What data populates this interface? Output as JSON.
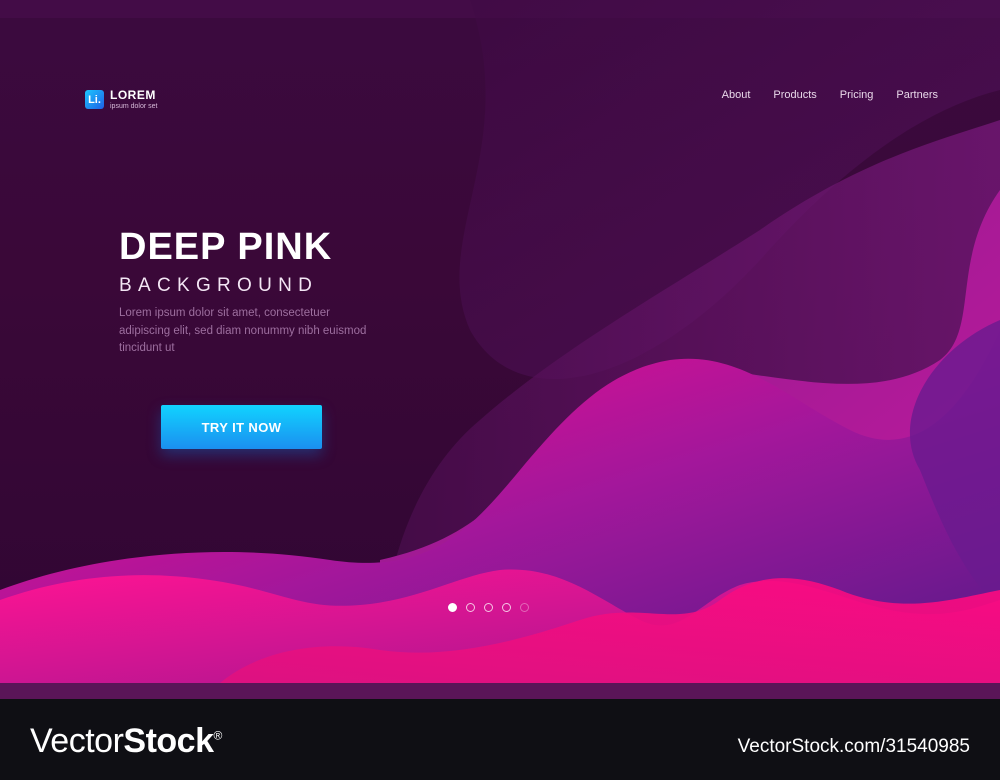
{
  "header": {
    "logo_mark": "Li.",
    "logo_name": "LOREM",
    "logo_tagline": "ipsum dolor set",
    "nav": [
      "About",
      "Products",
      "Pricing",
      "Partners"
    ]
  },
  "hero": {
    "title": "DEEP PINK",
    "subtitle": "BACKGROUND",
    "body": "Lorem ipsum dolor sit amet, consectetuer adipiscing elit, sed diam nonummy nibh euismod tincidunt ut",
    "cta_label": "TRY IT NOW"
  },
  "carousel": {
    "slide_count": 5,
    "active_index": 0
  },
  "footer": {
    "brand_regular": "Vector",
    "brand_bold": "Stock",
    "brand_mark": "®",
    "image_id": "VectorStock.com/31540985"
  },
  "colors": {
    "background": "#3b0a3f",
    "pink": "#ff0a8c",
    "magenta": "#c21a9c",
    "cta_blue": "#11d3ff"
  }
}
